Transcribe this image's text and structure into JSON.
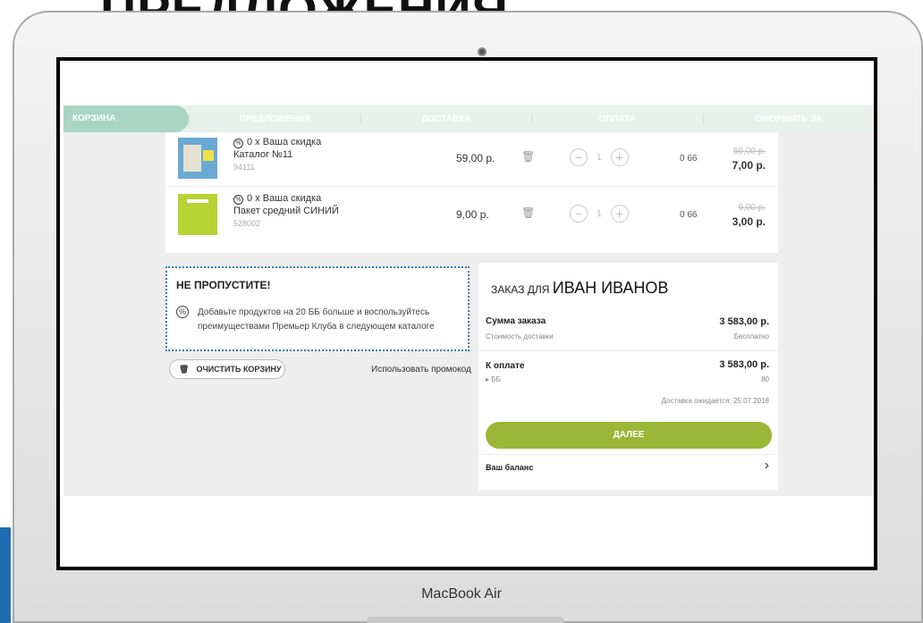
{
  "page": {
    "heading": "ПРЕДЛОЖЕНИЯ",
    "device_label": "MacBook Air"
  },
  "steps": [
    "КОРЗИНА",
    "ПРЕДЛОЖЕНИЯ",
    "ДОСТАВКА",
    "ОПЛАТА",
    "ОФОРМИТЬ ЗА"
  ],
  "cart": {
    "items": [
      {
        "discount": "0 х Ваша скидка",
        "name": "Каталог №11",
        "sku": "94111",
        "price": "59,00 р.",
        "qty": "1",
        "points": "0 66",
        "old_price": "59,00 р.",
        "new_price": "7,00 р.",
        "thumb_colors": [
          "#6aa9d4",
          "#f0e04a"
        ]
      },
      {
        "discount": "0 х Ваша скидка",
        "name": "Пакет средний СИНИЙ",
        "sku": "528002",
        "price": "9,00 р.",
        "qty": "1",
        "points": "0 66",
        "old_price": "9,00 р.",
        "new_price": "3,00 р.",
        "thumb_colors": [
          "#b7d233",
          "#ffffff"
        ]
      }
    ]
  },
  "promo": {
    "title": "НЕ ПРОПУСТИТЕ!",
    "text": "Добавьте продуктов на 20 ББ больше и воспользуйтесь преимуществами Премьер Клуба в следующем каталоге"
  },
  "clear_cart_label": "ОЧИСТИТЬ КОРЗИНУ",
  "promo_code_label": "Использовать промокод",
  "order": {
    "title": "ЗАКАЗ ДЛЯ",
    "customer": "ИВАН ИВАНОВ",
    "sum_label": "Сумма заказа",
    "sum_value": "3 583,00 р.",
    "delivery_label": "Стоимость доставки",
    "delivery_value": "Бесплатно",
    "to_pay_label": "К оплате",
    "to_pay_value": "3 583,00 р.",
    "bb_label": "▸ ББ",
    "bb_value": "80",
    "expected": "Доставка ожидается: 25.07.2018",
    "next_label": "ДАЛЕЕ",
    "balance_label": "Ваш баланс"
  },
  "colors": {
    "accent_green": "#9cb637",
    "steps_active": "#a9d5c4",
    "promo_border": "#2c7fa8"
  }
}
